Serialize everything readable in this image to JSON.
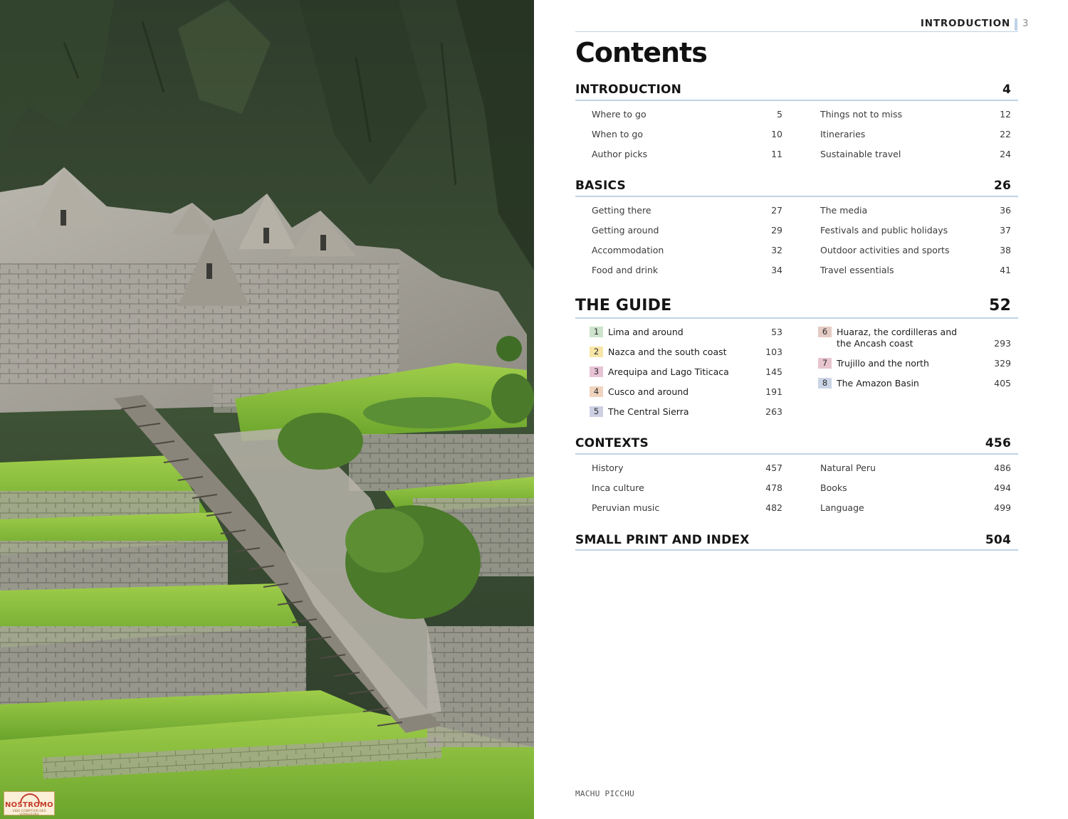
{
  "photo": {
    "alt_icon": "machu-picchu-photo",
    "logo_text": "NOSTROMO",
    "logo_subtext": "VIDE-COMPTOIR DES VOYAGEURS"
  },
  "header": {
    "running_head": "INTRODUCTION",
    "page_number": "3"
  },
  "title": "Contents",
  "sections": {
    "introduction": {
      "label": "INTRODUCTION",
      "page": "4",
      "left": [
        {
          "label": "Where to go",
          "page": "5"
        },
        {
          "label": "When to go",
          "page": "10"
        },
        {
          "label": "Author picks",
          "page": "11"
        }
      ],
      "right": [
        {
          "label": "Things not to miss",
          "page": "12"
        },
        {
          "label": "Itineraries",
          "page": "22"
        },
        {
          "label": "Sustainable travel",
          "page": "24"
        }
      ]
    },
    "basics": {
      "label": "BASICS",
      "page": "26",
      "left": [
        {
          "label": "Getting there",
          "page": "27"
        },
        {
          "label": "Getting around",
          "page": "29"
        },
        {
          "label": "Accommodation",
          "page": "32"
        },
        {
          "label": "Food and drink",
          "page": "34"
        }
      ],
      "right": [
        {
          "label": "The media",
          "page": "36"
        },
        {
          "label": "Festivals and public holidays",
          "page": "37"
        },
        {
          "label": "Outdoor activities and sports",
          "page": "38"
        },
        {
          "label": "Travel essentials",
          "page": "41"
        }
      ]
    },
    "guide": {
      "label": "THE GUIDE",
      "page": "52",
      "left": [
        {
          "num": "1",
          "label": "Lima and around",
          "page": "53",
          "color": "#cde3cc"
        },
        {
          "num": "2",
          "label": "Nazca and the south coast",
          "page": "103",
          "color": "#f7e6a6"
        },
        {
          "num": "3",
          "label": "Arequipa and Lago Titicaca",
          "page": "145",
          "color": "#e8c3d6"
        },
        {
          "num": "4",
          "label": "Cusco and around",
          "page": "191",
          "color": "#f0d3bf"
        },
        {
          "num": "5",
          "label": "The Central Sierra",
          "page": "263",
          "color": "#cdd0e2"
        }
      ],
      "right": [
        {
          "num": "6",
          "label": "Huaraz, the cordilleras and",
          "label2": "the Ancash coast",
          "page": "293",
          "color": "#e4cbc3"
        },
        {
          "num": "7",
          "label": "Trujillo and the north",
          "page": "329",
          "color": "#e8c4cf"
        },
        {
          "num": "8",
          "label": "The Amazon Basin",
          "page": "405",
          "color": "#c9d5e5"
        }
      ]
    },
    "contexts": {
      "label": "CONTEXTS",
      "page": "456",
      "left": [
        {
          "label": "History",
          "page": "457"
        },
        {
          "label": "Inca culture",
          "page": "478"
        },
        {
          "label": "Peruvian music",
          "page": "482"
        }
      ],
      "right": [
        {
          "label": "Natural Peru",
          "page": "486"
        },
        {
          "label": "Books",
          "page": "494"
        },
        {
          "label": "Language",
          "page": "499"
        }
      ]
    },
    "small_print": {
      "label": "SMALL PRINT AND INDEX",
      "page": "504"
    }
  },
  "caption": "MACHU PICCHU"
}
